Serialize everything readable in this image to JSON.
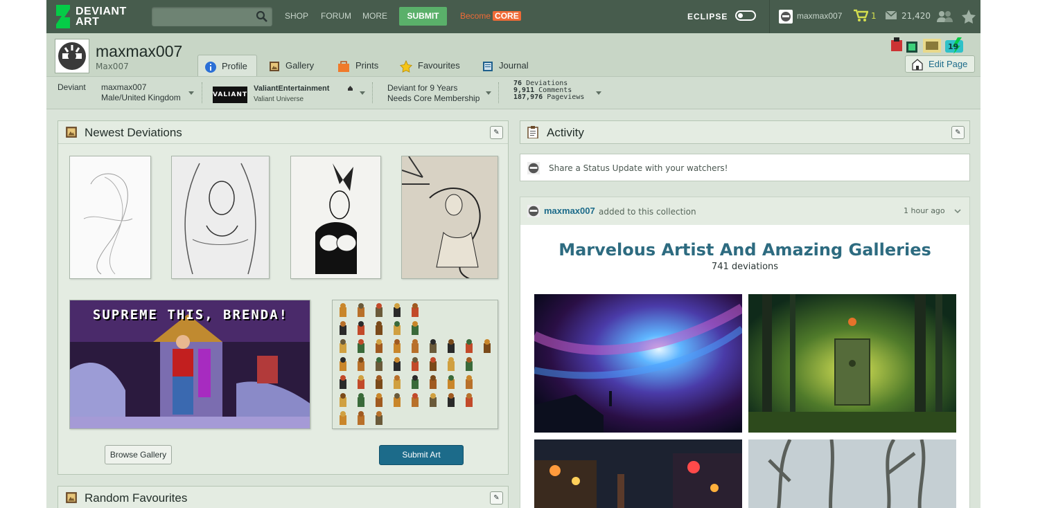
{
  "topbar": {
    "logo_line1": "DEVIANT",
    "logo_line2": "ART",
    "search_placeholder": "",
    "nav": [
      "SHOP",
      "FORUM",
      "MORE"
    ],
    "submit_label": "SUBMIT",
    "become_label": "Become",
    "core_label": "CORE",
    "eclipse_label": "ECLIPSE",
    "username": "maxmax007",
    "cart_count": "1",
    "mail_count": "21,420"
  },
  "profile": {
    "username": "maxmax007",
    "realname": "Max007",
    "tabs": [
      {
        "label": "Profile",
        "icon": "info-icon"
      },
      {
        "label": "Gallery",
        "icon": "gallery-icon"
      },
      {
        "label": "Prints",
        "icon": "prints-icon"
      },
      {
        "label": "Favourites",
        "icon": "star-icon"
      },
      {
        "label": "Journal",
        "icon": "journal-icon"
      }
    ],
    "edit_page": "Edit Page",
    "badge_count": "19"
  },
  "infobar": {
    "deviant_label": "Deviant",
    "username": "maxmax007",
    "location": "Male/United Kingdom",
    "group_logo": "VALIANT",
    "group_name": "ValiantEntertainment",
    "group_sub": "Valiant Universe",
    "deviant_for": "Deviant for 9 Years",
    "membership": "Needs Core Membership",
    "stats": [
      {
        "num": "76",
        "label": "Deviations"
      },
      {
        "num": "9,911",
        "label": "Comments"
      },
      {
        "num": "187,976",
        "label": "Pageviews"
      }
    ]
  },
  "newest": {
    "title": "Newest Deviations",
    "banner_text": "SUPREME THIS, BRENDA!",
    "browse_label": "Browse Gallery",
    "submit_label": "Submit Art"
  },
  "random_fav": {
    "title": "Random Favourites"
  },
  "activity": {
    "title": "Activity",
    "status_placeholder": "Share a Status Update with your watchers!",
    "feed_user": "maxmax007",
    "feed_action": "added to this collection",
    "feed_time": "1 hour ago",
    "collection_title": "Marvelous Artist And Amazing Galleries",
    "collection_count": "741 deviations"
  },
  "colors": {
    "topbar": "#475c4d",
    "page_bg": "#dae4d9",
    "accent_green": "#5ab06a",
    "core_orange": "#f06a36",
    "link_blue": "#1c6b8a"
  }
}
